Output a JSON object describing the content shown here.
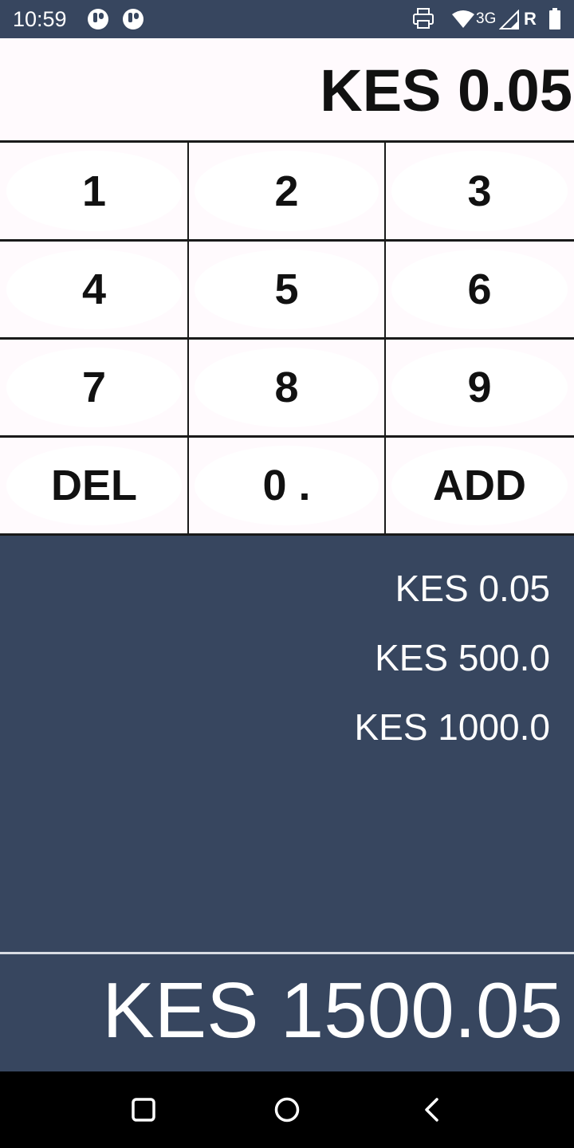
{
  "status_bar": {
    "time": "10:59",
    "network": "3G",
    "roaming": "R",
    "icons": [
      "app-notification-icon",
      "app-notification-icon",
      "printer-icon",
      "wifi-icon",
      "signal-icon",
      "battery-icon"
    ]
  },
  "display": {
    "current_amount": "KES 0.05"
  },
  "keypad": {
    "keys": [
      "1",
      "2",
      "3",
      "4",
      "5",
      "6",
      "7",
      "8",
      "9",
      "DEL",
      "0 .",
      "ADD"
    ]
  },
  "history": {
    "entries": [
      "KES 0.05",
      "KES 500.0",
      "KES 1000.0"
    ]
  },
  "total": {
    "amount": "KES 1500.05"
  },
  "nav_bar": {
    "icons": [
      "recents-icon",
      "home-icon",
      "back-icon"
    ]
  },
  "colors": {
    "header_bg": "#37465f",
    "keypad_bg": "#fffafd",
    "divider": "#1a1a1a",
    "text_light": "#ffffff",
    "text_dark": "#111111"
  }
}
